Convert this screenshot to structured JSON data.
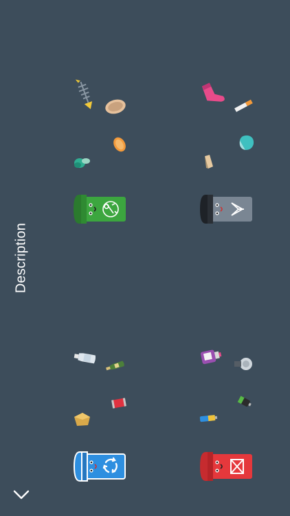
{
  "description_label": "Description",
  "icons": {
    "organic_bin": "organic-bin-icon",
    "general_bin": "general-waste-bin-icon",
    "recycle_bin": "recycle-bin-icon",
    "hazardous_bin": "hazardous-bin-icon",
    "chevron": "chevron-down-icon"
  },
  "colors": {
    "background": "#3d4d5b",
    "organic_bin": "#3ca63f",
    "general_bin": "#7a8693",
    "recycle_bin": "#2e8fe0",
    "hazardous_bin": "#e5383c"
  }
}
